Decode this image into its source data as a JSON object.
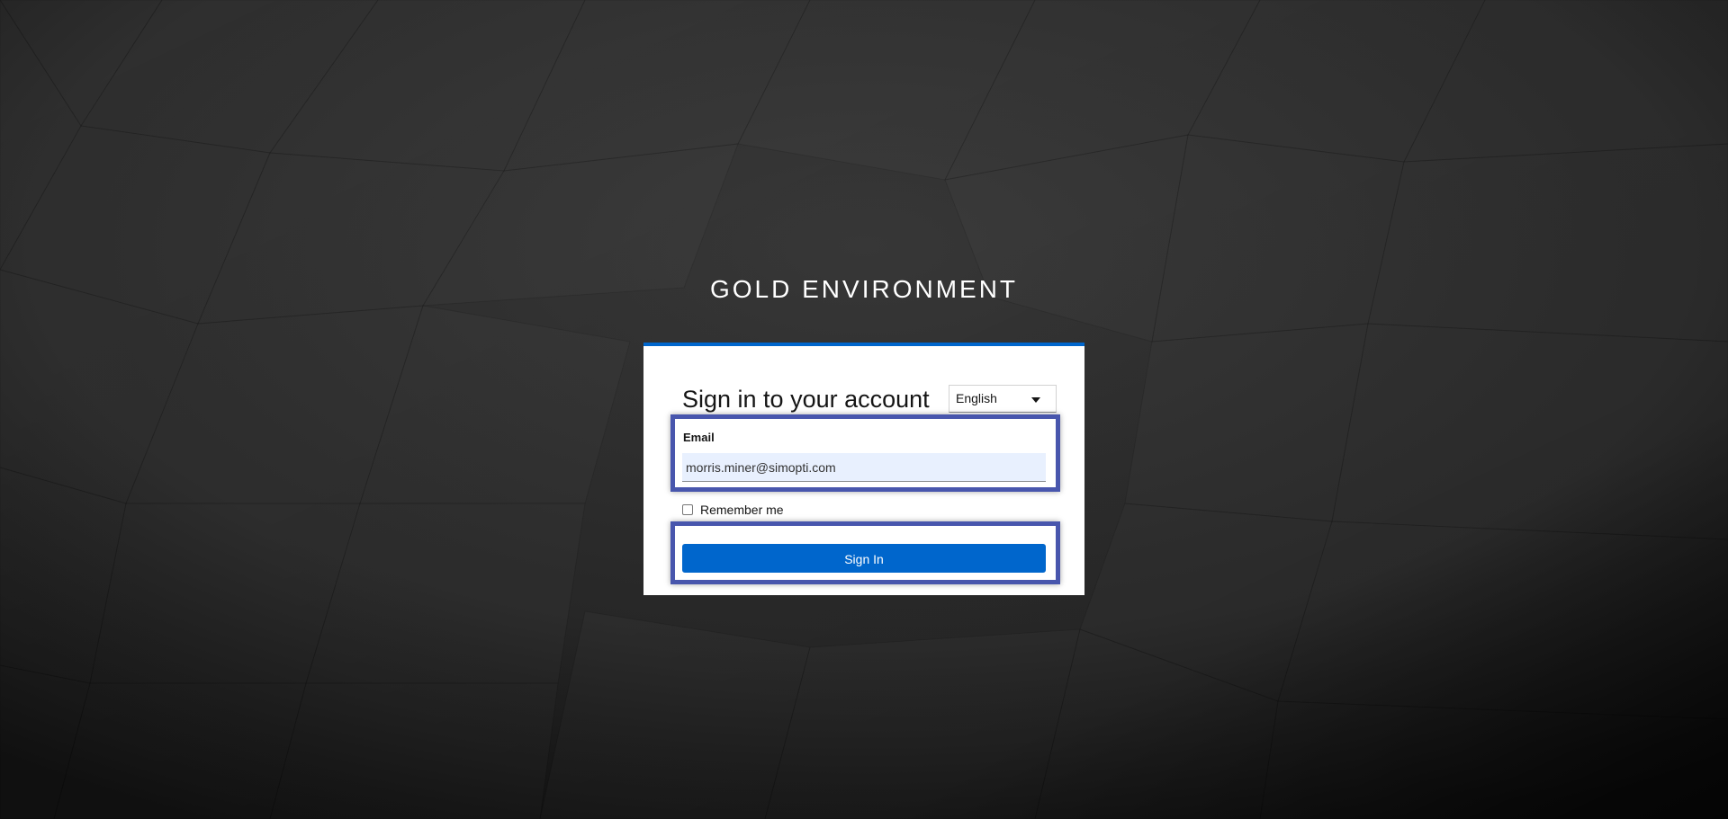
{
  "realm": {
    "title": "GOLD ENVIRONMENT"
  },
  "login": {
    "heading": "Sign in to your account",
    "language": {
      "selected": "English",
      "icon": "caret-down-icon"
    },
    "email": {
      "label": "Email",
      "value": "morris.miner@simopti.com"
    },
    "remember_me": {
      "label": "Remember me",
      "checked": false
    },
    "submit_label": "Sign In"
  },
  "colors": {
    "accent": "#0066cc",
    "highlight": "#4856ad",
    "input_bg": "#e8f0fe",
    "background": "#2b2b2b"
  }
}
